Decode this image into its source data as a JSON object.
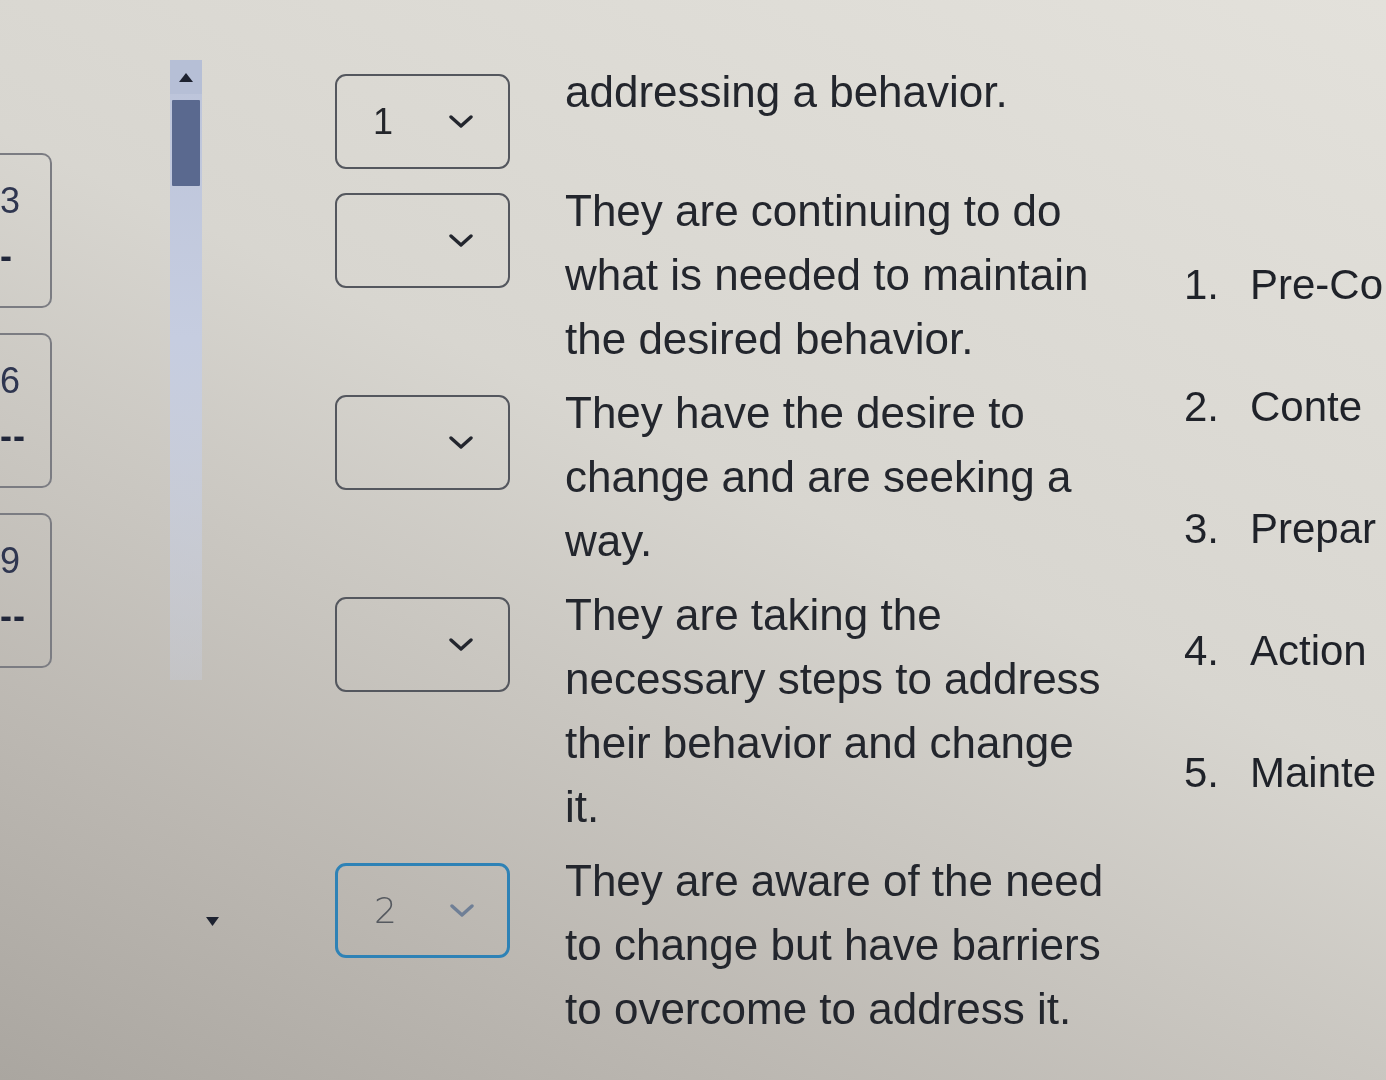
{
  "question_nav": [
    {
      "number": "3",
      "status": "-"
    },
    {
      "number": "6",
      "status": "--"
    },
    {
      "number": "9",
      "status": "--"
    }
  ],
  "matching_rows": [
    {
      "answer": {
        "value": "1",
        "focused": false
      },
      "statement": "addressing a behavior."
    },
    {
      "answer": {
        "focused": false
      },
      "statement": "They are continuing to do what is needed to maintain the desired behavior."
    },
    {
      "answer": {
        "focused": false
      },
      "statement": "They have the desire to change and are seeking a way."
    },
    {
      "answer": {
        "focused": false
      },
      "statement": "They are taking the necessary steps to address their behavior and change it."
    },
    {
      "answer": {
        "value": "2",
        "focused": true
      },
      "statement": "They are aware of the need to change but have barriers to overcome to address it."
    }
  ],
  "choices": [
    {
      "number": "1.",
      "text": "Pre-Co"
    },
    {
      "number": "2.",
      "text": "Conte"
    },
    {
      "number": "3.",
      "text": "Prepar"
    },
    {
      "number": "4.",
      "text": "Action"
    },
    {
      "number": "5.",
      "text": "Mainte"
    }
  ]
}
